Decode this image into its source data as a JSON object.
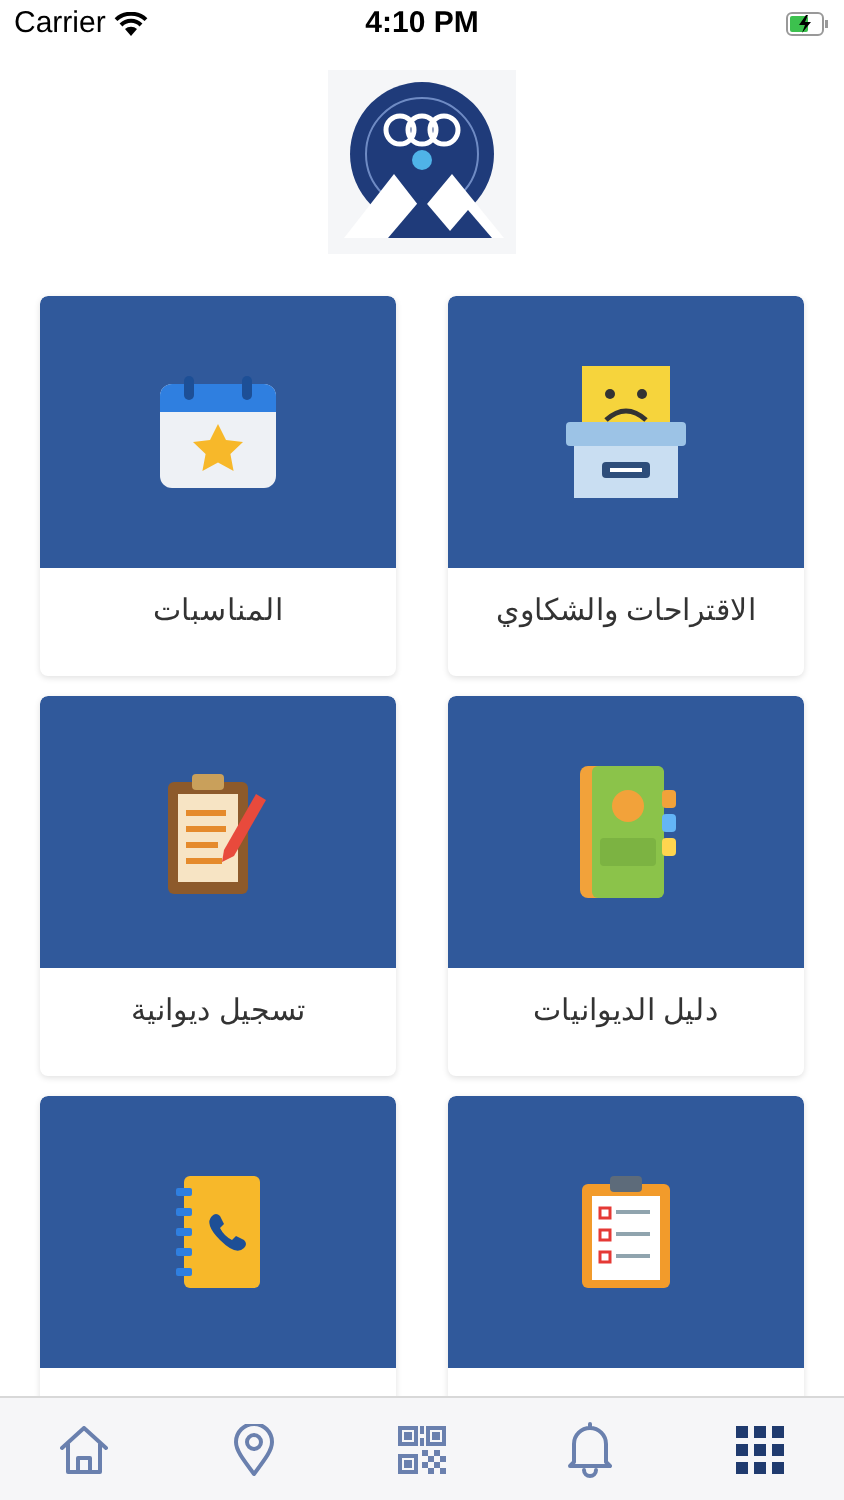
{
  "status_bar": {
    "carrier": "Carrier",
    "time": "4:10 PM"
  },
  "tiles": [
    {
      "kind": "complaints",
      "label": "الاقتراحات والشكاوي"
    },
    {
      "kind": "calendar",
      "label": "المناسبات"
    },
    {
      "kind": "directory",
      "label": "دليل الديوانيات"
    },
    {
      "kind": "register",
      "label": "تسجيل ديوانية"
    },
    {
      "kind": "checklist"
    },
    {
      "kind": "phonebook"
    }
  ],
  "tab_bar": [
    {
      "kind": "home",
      "selected": false
    },
    {
      "kind": "location",
      "selected": false
    },
    {
      "kind": "qr",
      "selected": false
    },
    {
      "kind": "bell",
      "selected": false
    },
    {
      "kind": "grid",
      "selected": true
    }
  ]
}
